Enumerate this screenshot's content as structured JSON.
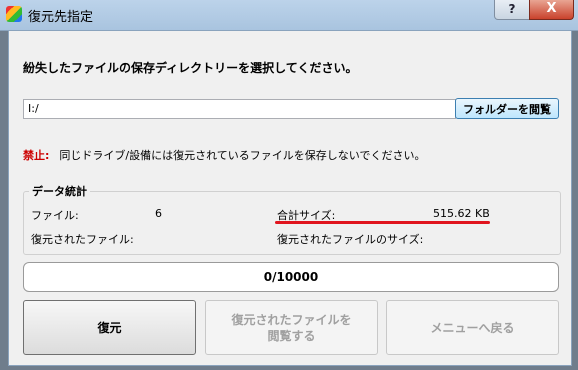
{
  "window": {
    "title": "復元先指定",
    "help_label": "?",
    "close_label": "X"
  },
  "heading": "紛失したファイルの保存ディレクトリーを選択してください。",
  "path_input": {
    "value": "I:/"
  },
  "browse_button": "フォルダーを閲覧",
  "warning": {
    "label": "禁止:",
    "text": "同じドライブ/設備には復元されているファイルを保存しないでください。"
  },
  "stats": {
    "title": "データ統計",
    "files_label": "ファイル:",
    "files_value": "6",
    "total_size_label": "合計サイズ:",
    "total_size_value": "515.62 KB",
    "recovered_files_label": "復元されたファイル:",
    "recovered_size_label": "復元されたファイルのサイズ:"
  },
  "progress": {
    "text": "0/10000",
    "fraction": 0
  },
  "buttons": {
    "restore": "復元",
    "browse_recovered_line1": "復元されたファイルを",
    "browse_recovered_line2": "閲覧する",
    "back_to_menu": "メニューへ戻る"
  },
  "colors": {
    "warning": "#cc0000",
    "annotation": "#e0141e",
    "title_bar": "#bcd3ea"
  }
}
